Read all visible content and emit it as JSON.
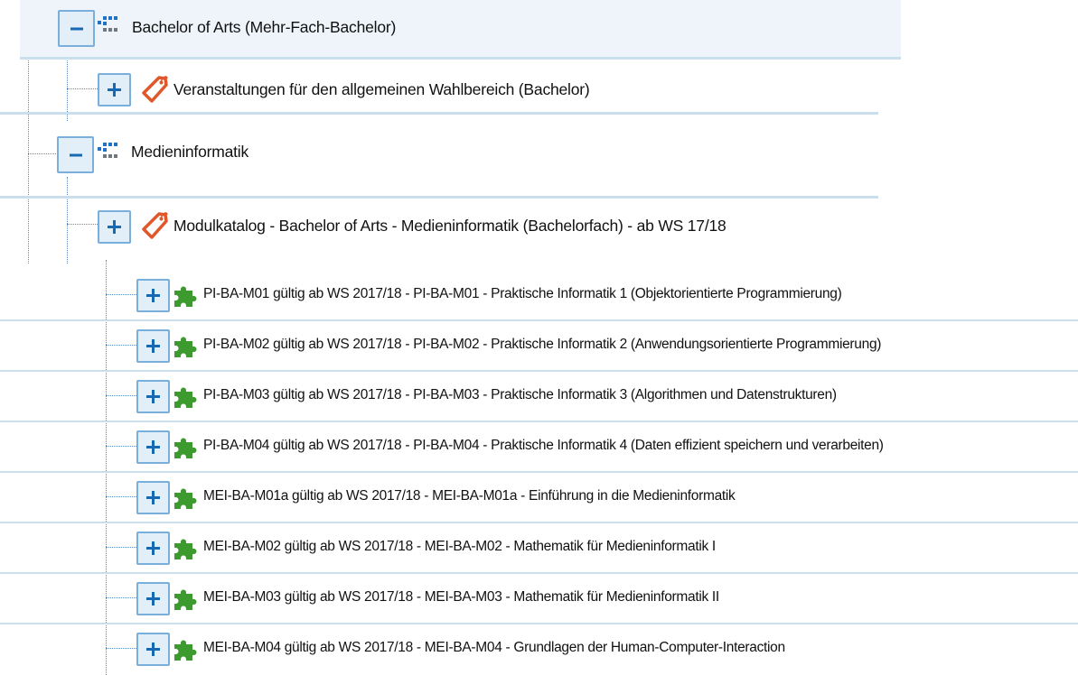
{
  "tree": {
    "nodes": [
      {
        "label": "Bachelor of Arts (Mehr-Fach-Bachelor)",
        "toggle": "−",
        "state": "expanded",
        "icon": "degree-program-icon"
      },
      {
        "label": "Veranstaltungen für den allgemeinen Wahlbereich (Bachelor)",
        "toggle": "+",
        "state": "collapsed",
        "icon": "tag-icon"
      },
      {
        "label": "Medieninformatik",
        "toggle": "−",
        "state": "expanded",
        "icon": "degree-program-icon"
      },
      {
        "label": "Modulkatalog - Bachelor of Arts - Medieninformatik (Bachelorfach) - ab WS 17/18",
        "toggle": "+",
        "state": "collapsed",
        "icon": "tag-icon"
      },
      {
        "label": "PI-BA-M01 gültig ab WS 2017/18 - PI-BA-M01 - Praktische Informatik 1 (Objektorientierte Programmierung)",
        "toggle": "+",
        "state": "collapsed",
        "icon": "puzzle-piece-icon"
      },
      {
        "label": "PI-BA-M02 gültig ab WS 2017/18 - PI-BA-M02 - Praktische Informatik 2 (Anwendungsorientierte Programmierung)",
        "toggle": "+",
        "state": "collapsed",
        "icon": "puzzle-piece-icon"
      },
      {
        "label": "PI-BA-M03 gültig ab WS 2017/18 - PI-BA-M03 - Praktische Informatik 3 (Algorithmen und Datenstrukturen)",
        "toggle": "+",
        "state": "collapsed",
        "icon": "puzzle-piece-icon"
      },
      {
        "label": "PI-BA-M04 gültig ab WS 2017/18 - PI-BA-M04 - Praktische Informatik 4 (Daten effizient speichern und verarbeiten)",
        "toggle": "+",
        "state": "collapsed",
        "icon": "puzzle-piece-icon"
      },
      {
        "label": "MEI-BA-M01a gültig ab WS 2017/18 - MEI-BA-M01a - Einführung in die Medieninformatik",
        "toggle": "+",
        "state": "collapsed",
        "icon": "puzzle-piece-icon"
      },
      {
        "label": "MEI-BA-M02 gültig ab WS 2017/18 - MEI-BA-M02 - Mathematik für Medieninformatik I",
        "toggle": "+",
        "state": "collapsed",
        "icon": "puzzle-piece-icon"
      },
      {
        "label": "MEI-BA-M03 gültig ab WS 2017/18 - MEI-BA-M03 - Mathematik für Medieninformatik II",
        "toggle": "+",
        "state": "collapsed",
        "icon": "puzzle-piece-icon"
      },
      {
        "label": "MEI-BA-M04 gültig ab WS 2017/18 - MEI-BA-M04 - Grundlagen der Human-Computer-Interaction",
        "toggle": "+",
        "state": "collapsed",
        "icon": "puzzle-piece-icon"
      }
    ]
  },
  "colors": {
    "toggle_background": "#e3eff8",
    "toggle_border": "#7aaedb",
    "toggle_glyph": "#1769b4",
    "row_separator": "#c9dfee",
    "selected_row_background": "#eef4fa",
    "connector_line": "#5b8fc7",
    "degree_icon_blue": "#1f72c4",
    "degree_icon_gray": "#6f7780",
    "tag_icon": "#e0572a",
    "puzzle_icon": "#3c9a2e"
  }
}
